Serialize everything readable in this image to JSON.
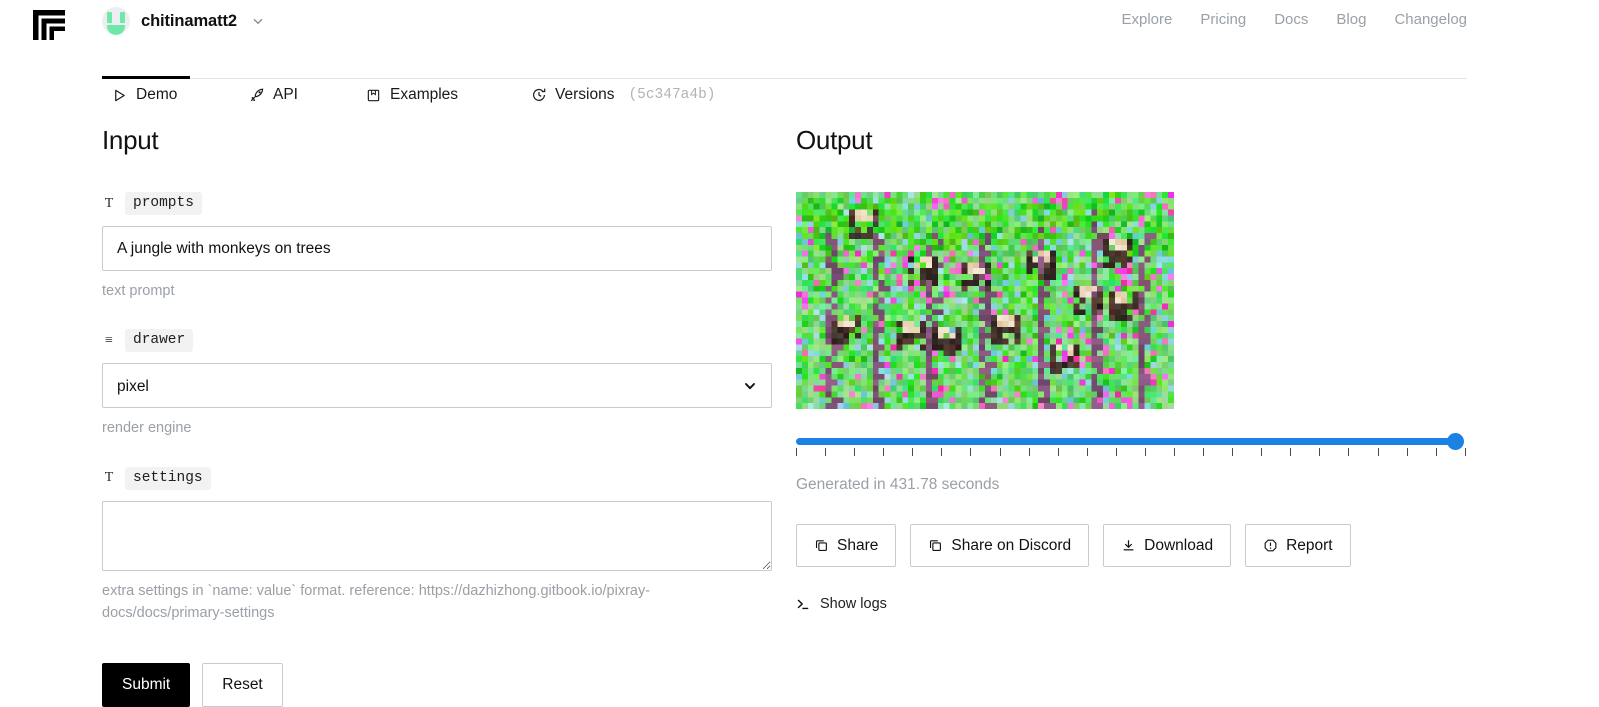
{
  "header": {
    "logo_icon": "replicate-logo-icon",
    "owner": {
      "name": "chitinamatt2",
      "caret_icon": "chevron-down-icon",
      "avatar_icon": "user-avatar"
    },
    "nav": [
      {
        "label": "Explore"
      },
      {
        "label": "Pricing"
      },
      {
        "label": "Docs"
      },
      {
        "label": "Blog"
      },
      {
        "label": "Changelog"
      }
    ]
  },
  "tabs": [
    {
      "label": "Demo",
      "icon": "play-icon",
      "active": true
    },
    {
      "label": "API",
      "icon": "rocket-icon",
      "active": false
    },
    {
      "label": "Examples",
      "icon": "book-icon",
      "active": false
    },
    {
      "label": "Versions",
      "icon": "history-icon",
      "active": false,
      "hash": "(5c347a4b)"
    }
  ],
  "input": {
    "title": "Input",
    "fields": [
      {
        "name": "prompts",
        "type_icon": "text-type-icon",
        "type_glyph": "T",
        "value": "A jungle with monkeys on trees",
        "placeholder": "",
        "help": "text prompt"
      },
      {
        "name": "drawer",
        "type_icon": "list-type-icon",
        "type_glyph": "≡",
        "value": "pixel",
        "options": [
          "pixel"
        ],
        "help": "render engine",
        "chevron_icon": "chevron-down-icon"
      },
      {
        "name": "settings",
        "type_icon": "text-type-icon",
        "type_glyph": "T",
        "value": "",
        "placeholder": "",
        "help": "extra settings in `name: value` format. reference: https://dazhizhong.gitbook.io/pixray-docs/docs/primary-settings"
      }
    ],
    "submit_label": "Submit",
    "reset_label": "Reset"
  },
  "output": {
    "title": "Output",
    "image_alt": "pixel-art jungle with monkeys on trees",
    "slider": {
      "value": 100,
      "min": 0,
      "max": 100,
      "tick_count": 24
    },
    "status": "Generated in 431.78 seconds",
    "buttons": [
      {
        "label": "Share",
        "icon": "copy-icon"
      },
      {
        "label": "Share on Discord",
        "icon": "copy-icon"
      },
      {
        "label": "Download",
        "icon": "download-icon"
      },
      {
        "label": "Report",
        "icon": "alert-octagon-icon"
      }
    ],
    "show_logs_label": "Show logs",
    "show_logs_icon": "terminal-icon"
  },
  "colors": {
    "accent_blue": "#1a82e2",
    "avatar_green": "#6ee7a8",
    "muted_text": "#9aa0a6",
    "border": "#c8ccd0"
  }
}
